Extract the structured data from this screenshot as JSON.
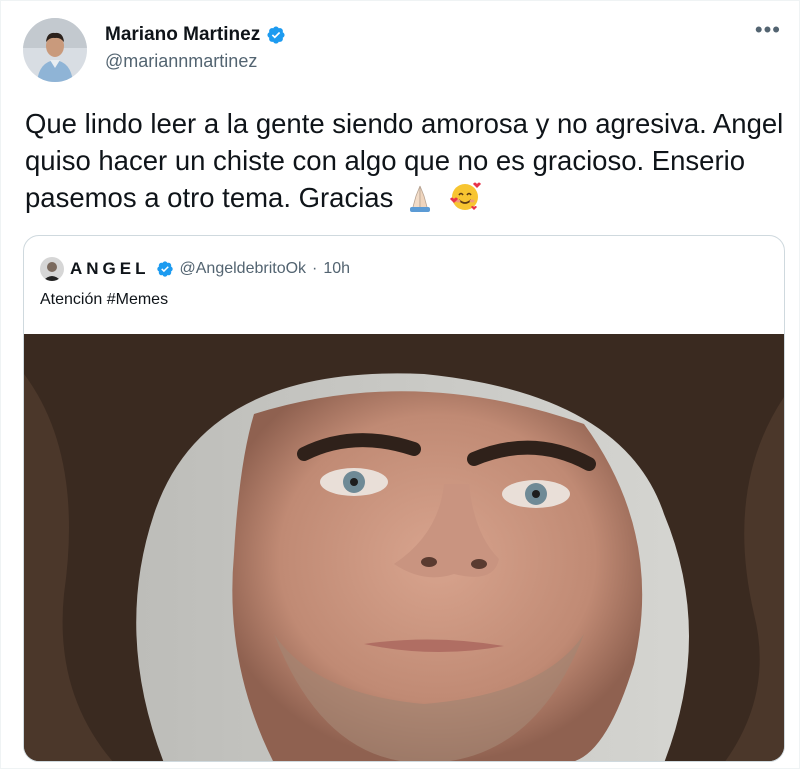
{
  "author": {
    "display_name": "Mariano Martinez",
    "handle": "@mariannmartinez",
    "verified": true
  },
  "menu": {
    "more_label": "•••"
  },
  "tweet": {
    "text": "Que lindo leer a la gente siendo amorosa y no agresiva. Angel quiso hacer un chiste con algo que no es gracioso. Enserio pasemos a otro tema. Gracias",
    "emojis": [
      "folded-hands-icon",
      "smiling-face-with-hearts-icon"
    ]
  },
  "quoted_tweet": {
    "display_name": "ANGEL",
    "handle": "@AngeldebritoOk",
    "separator": "·",
    "time": "10h",
    "text": "Atención #Memes",
    "media": "selfie-photo"
  },
  "colors": {
    "verified_blue": "#1d9bf0",
    "secondary_text": "#536471",
    "border": "#cfd9de"
  }
}
